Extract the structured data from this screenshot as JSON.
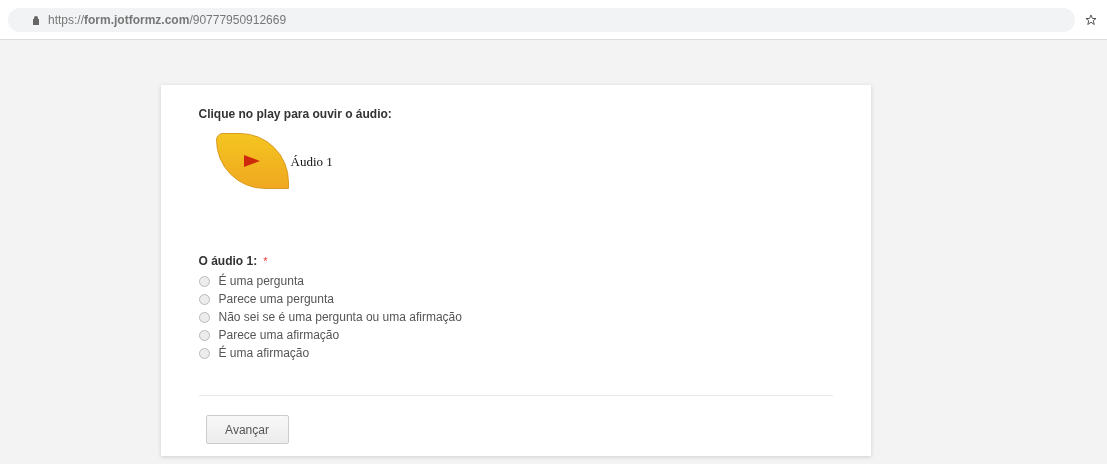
{
  "browser": {
    "url": "https://**form.jotformz.com**/90777950912669"
  },
  "form": {
    "instruction": "Clique no play para ouvir o áudio:",
    "audio": {
      "label": "Áudio 1"
    },
    "question": {
      "label": "O áudio 1:",
      "required_mark": "*",
      "options": [
        {
          "label": "É uma pergunta",
          "selected": false
        },
        {
          "label": "Parece uma pergunta",
          "selected": false
        },
        {
          "label": "Não sei se é uma pergunta ou uma afirmação",
          "selected": false
        },
        {
          "label": "Parece uma afirmação",
          "selected": false
        },
        {
          "label": "É uma afirmação",
          "selected": false
        }
      ]
    },
    "submit": "Avançar"
  }
}
